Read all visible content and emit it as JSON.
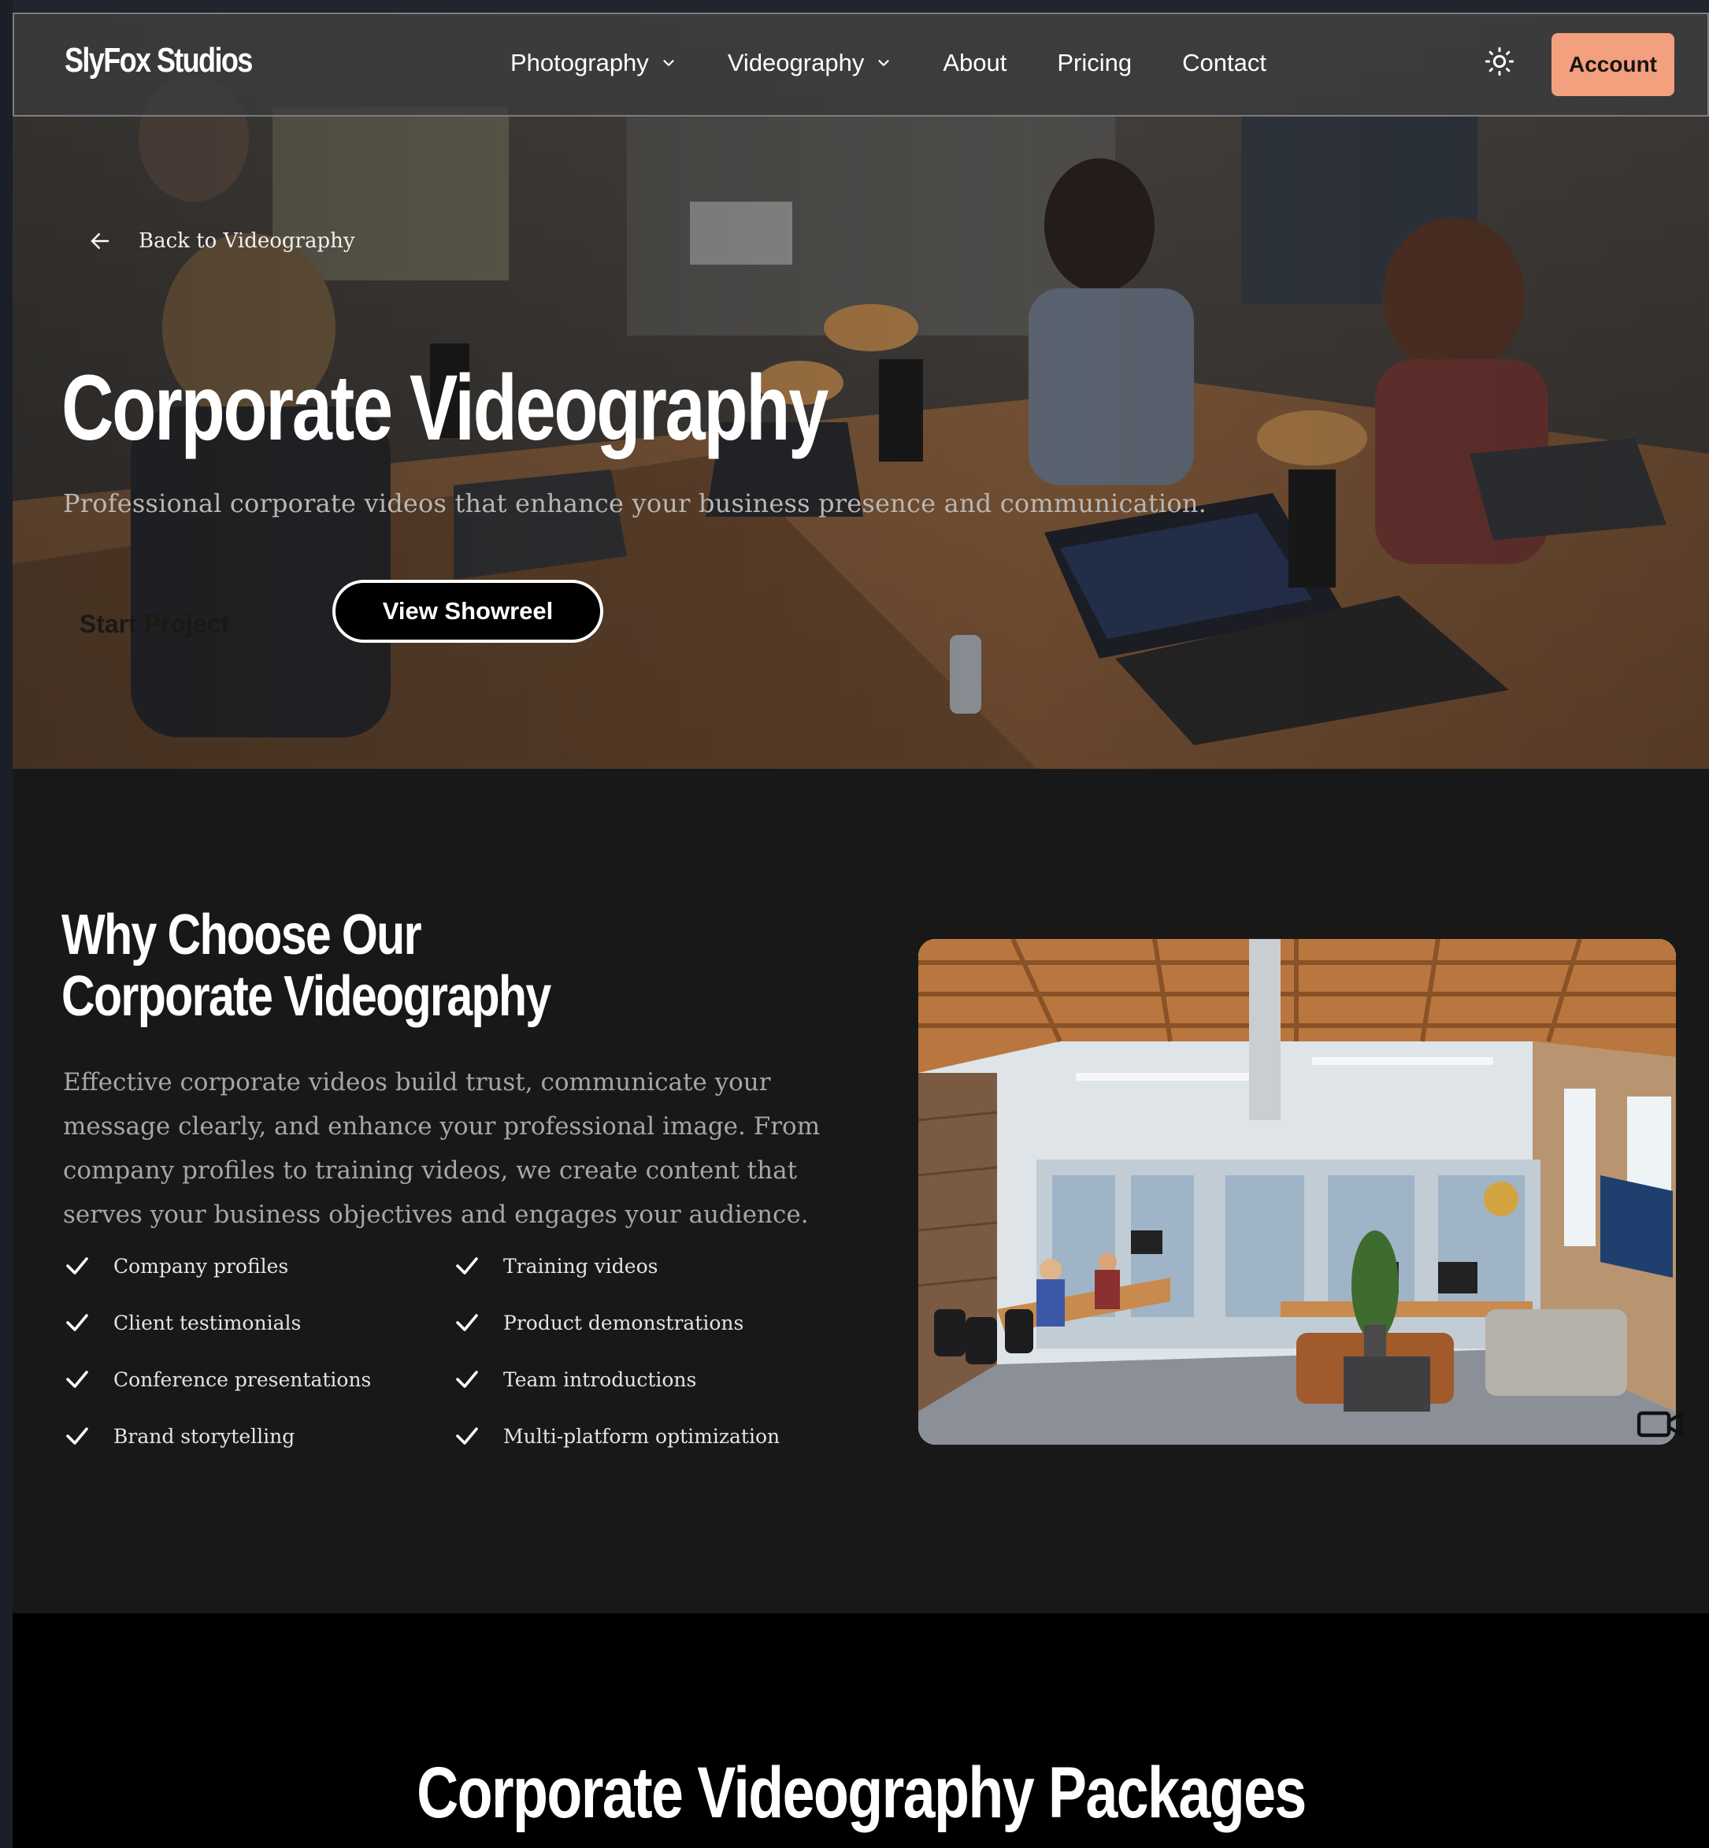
{
  "brand": {
    "name": "SlyFox Studios"
  },
  "nav": {
    "items": [
      {
        "label": "Photography",
        "has_dropdown": true
      },
      {
        "label": "Videography",
        "has_dropdown": true
      },
      {
        "label": "About",
        "has_dropdown": false
      },
      {
        "label": "Pricing",
        "has_dropdown": false
      },
      {
        "label": "Contact",
        "has_dropdown": false
      }
    ],
    "theme_toggle_icon": "sun-icon",
    "account_label": "Account"
  },
  "hero": {
    "back_label": "Back to Videography",
    "title": "Corporate Videography",
    "subtitle": "Professional corporate videos that enhance your business presence and communication.",
    "primary_button": "Start Project",
    "secondary_button": "View Showreel"
  },
  "why": {
    "title": "Why Choose Our Corporate Videography",
    "body": "Effective corporate videos build trust, communicate your message clearly, and enhance your professional image. From company profiles to training videos, we create content that serves your business objectives and engages your audience.",
    "features": [
      "Company profiles",
      "Training videos",
      "Client testimonials",
      "Product demonstrations",
      "Conference presentations",
      "Team introductions",
      "Brand storytelling",
      "Multi-platform optimization"
    ],
    "image_icon": "video-camera-icon"
  },
  "packages": {
    "title": "Corporate Videography Packages"
  },
  "colors": {
    "accent": "#f2a07e",
    "page_bg": "#181818",
    "packages_bg": "#000000",
    "body_text": "#a9a6a2"
  }
}
